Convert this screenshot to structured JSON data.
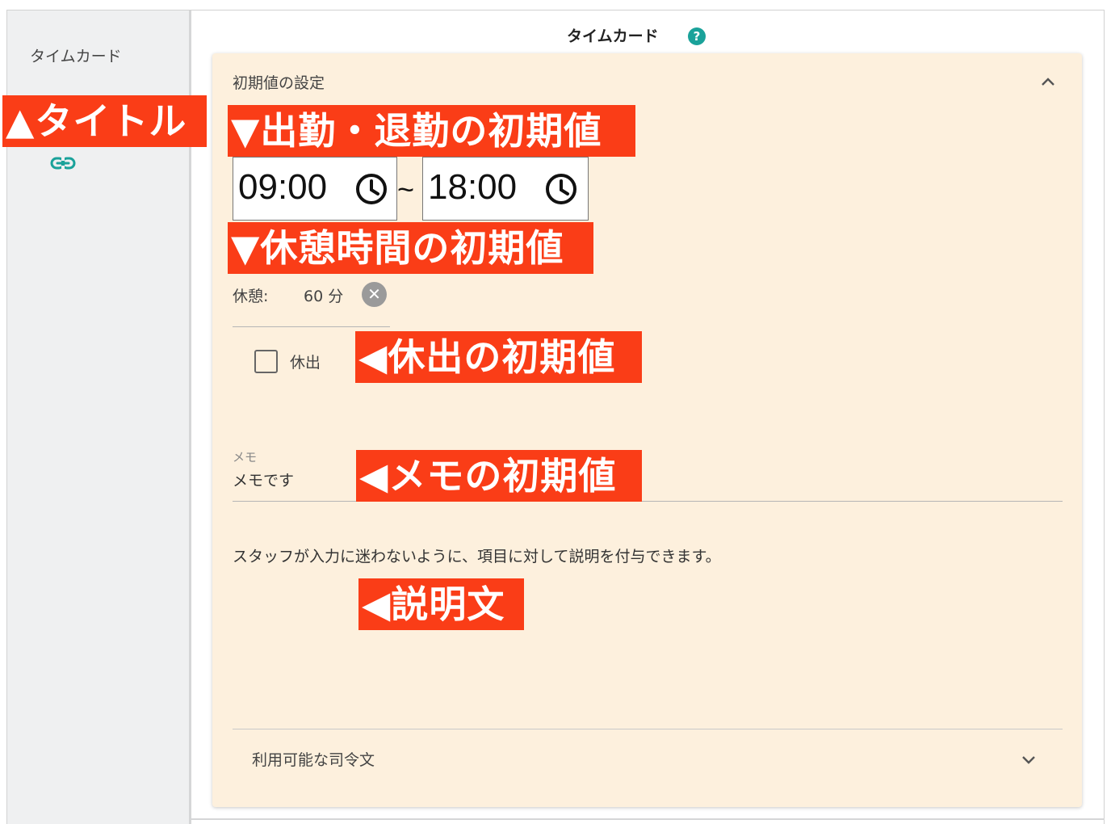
{
  "sidebar": {
    "title": "タイムカード",
    "link_icon": "link-icon"
  },
  "header": {
    "title": "タイムカード",
    "help_label": "?"
  },
  "card": {
    "title": "初期値の設定",
    "collapse_icon": "chevron-up-icon",
    "start_time": "09:00",
    "end_time": "18:00",
    "range_separator": "~",
    "break_label": "休憩:",
    "break_value": "60 分",
    "clear_label": "✕",
    "holiday_checkbox": {
      "label": "休出",
      "checked": false
    },
    "memo": {
      "label": "メモ",
      "value": "メモです"
    },
    "description": "スタッフが入力に迷わないように、項目に対して説明を付与できます。",
    "commands_label": "利用可能な司令文",
    "expand_icon": "chevron-down-icon"
  },
  "annotations": {
    "title": "▲タイトル",
    "work_time": "▼出勤・退勤の初期値",
    "break_time": "▼休憩時間の初期値",
    "holiday": "◀休出の初期値",
    "memo": "◀メモの初期値",
    "description": "◀説明文"
  },
  "colors": {
    "annotation_bg": "#fa3d17",
    "card_bg": "#fdf0dd",
    "sidebar_bg": "#eff0f1",
    "accent": "#1aa29a"
  }
}
